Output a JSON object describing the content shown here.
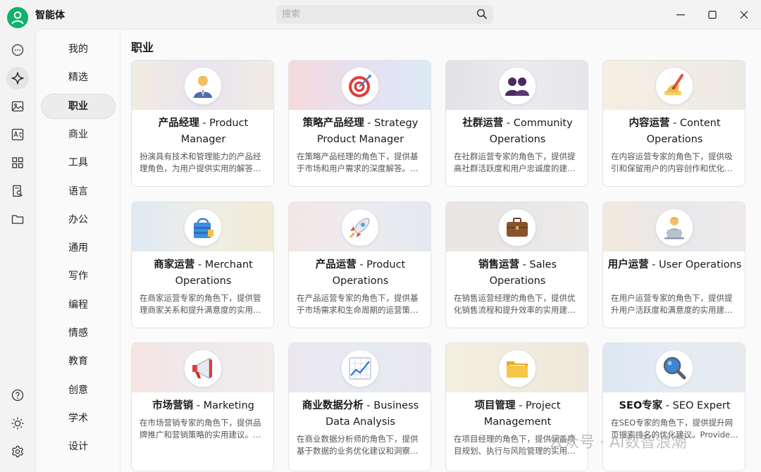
{
  "app": {
    "title": "智能体"
  },
  "search": {
    "placeholder": "搜索"
  },
  "categories": [
    "我的",
    "精选",
    "职业",
    "商业",
    "工具",
    "语言",
    "办公",
    "通用",
    "写作",
    "编程",
    "情感",
    "教育",
    "创意",
    "学术",
    "设计"
  ],
  "active_category": "职业",
  "section_title": "职业",
  "cards": [
    {
      "cn": "产品经理",
      "en": " - Product Manager",
      "desc": "扮演具有技术和管理能力的产品经理角色，为用户提供实用的解答…",
      "icon": "business-person-icon"
    },
    {
      "cn": "策略产品经理",
      "en": " - Strategy Product Manager",
      "desc": "在策略产品经理的角色下，提供基于市场和用户需求的深度解答。…",
      "icon": "target-icon"
    },
    {
      "cn": "社群运营",
      "en": " - Community Operations",
      "desc": "在社群运营专家的角色下，提供提高社群活跃度和用户忠诚度的建…",
      "icon": "people-icon"
    },
    {
      "cn": "内容运营",
      "en": " - Content Operations",
      "desc": "在内容运营专家的角色下，提供吸引和保留用户的内容创作和优化…",
      "icon": "writing-hand-icon"
    },
    {
      "cn": "商家运营",
      "en": " - Merchant Operations",
      "desc": "在商家运营专家的角色下，提供管理商家关系和提升满意度的实用…",
      "icon": "shopping-bag-icon"
    },
    {
      "cn": "产品运营",
      "en": " - Product Operations",
      "desc": "在产品运营专家的角色下，提供基于市场需求和生命周期的运营策…",
      "icon": "rocket-icon"
    },
    {
      "cn": "销售运营",
      "en": " - Sales Operations",
      "desc": "在销售运营经理的角色下，提供优化销售流程和提升效率的实用建…",
      "icon": "briefcase-icon"
    },
    {
      "cn": "用户运营",
      "en": " - User Operations",
      "desc": "在用户运营专家的角色下，提供提升用户活跃度和满意度的实用建…",
      "icon": "laptop-person-icon"
    },
    {
      "cn": "市场营销",
      "en": " - Marketing",
      "desc": "在市场营销专家的角色下，提供品牌推广和营销策略的实用建议。…",
      "icon": "megaphone-icon"
    },
    {
      "cn": "商业数据分析",
      "en": " - Business Data Analysis",
      "desc": "在商业数据分析师的角色下，提供基于数据的业务优化建议和洞察…",
      "icon": "chart-up-icon"
    },
    {
      "cn": "项目管理",
      "en": " - Project Management",
      "desc": "在项目经理的角色下，提供涵盖项目规划、执行与风险管理的实用…",
      "icon": "folder-icon"
    },
    {
      "cn": "SEO专家",
      "en": " - SEO Expert",
      "desc": "在SEO专家的角色下，提供提升网页搜索排名的优化建议。Provide…",
      "icon": "magnifier-icon"
    }
  ],
  "watermark": "公众号 · AI数智浪潮",
  "colors": {
    "brand": "#0fb36b",
    "active_bg": "#ececec"
  }
}
